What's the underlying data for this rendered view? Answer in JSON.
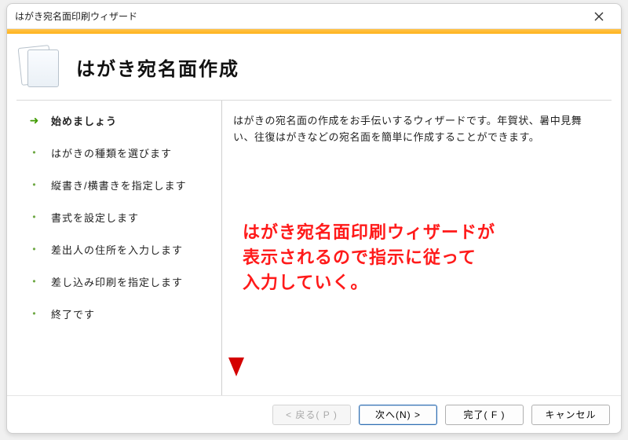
{
  "window": {
    "title": "はがき宛名面印刷ウィザード"
  },
  "header": {
    "title": "はがき宛名面作成"
  },
  "steps": [
    {
      "label": "始めましょう",
      "active": true
    },
    {
      "label": "はがきの種類を選びます",
      "active": false
    },
    {
      "label": "縦書き/横書きを指定します",
      "active": false
    },
    {
      "label": "書式を設定します",
      "active": false
    },
    {
      "label": "差出人の住所を入力します",
      "active": false
    },
    {
      "label": "差し込み印刷を指定します",
      "active": false
    },
    {
      "label": "終了です",
      "active": false
    }
  ],
  "content": {
    "description": "はがきの宛名面の作成をお手伝いするウィザードです。年賀状、暑中見舞い、往復はがきなどの宛名面を簡単に作成することができます。"
  },
  "annotation": {
    "line1": "はがき宛名面印刷ウィザードが",
    "line2": "表示されるので指示に従って",
    "line3": "入力していく。"
  },
  "footer": {
    "back": "< 戻る( P )",
    "next": "次へ(N) >",
    "finish": "完了( F )",
    "cancel": "キャンセル"
  }
}
